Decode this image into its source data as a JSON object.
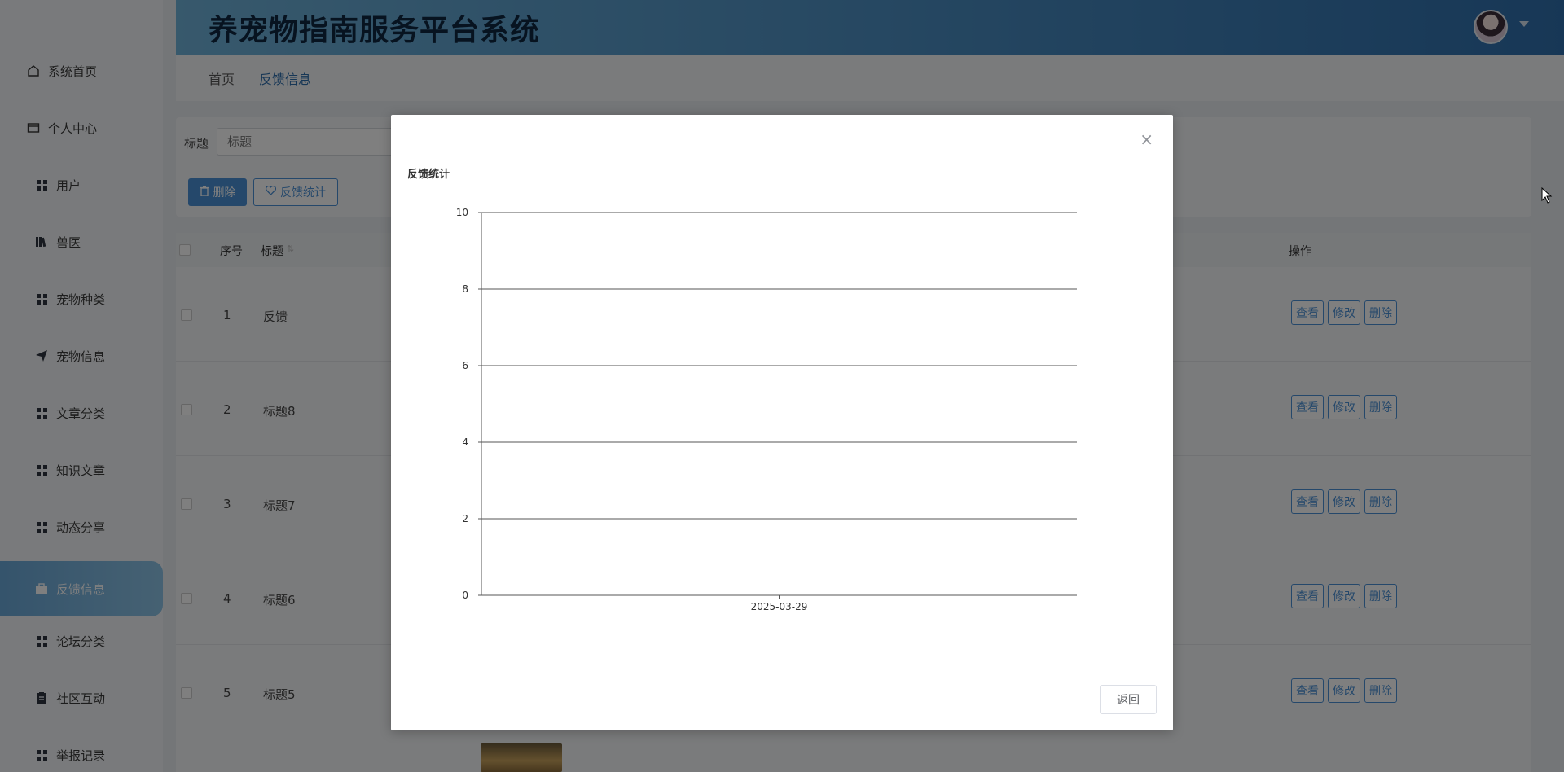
{
  "header": {
    "title": "养宠物指南服务平台系统"
  },
  "sidebar": {
    "items": [
      {
        "label": "系统首页",
        "icon": "home-icon"
      },
      {
        "label": "个人中心",
        "icon": "wallet-icon"
      },
      {
        "label": "用户",
        "icon": "grid-icon"
      },
      {
        "label": "兽医",
        "icon": "library-icon"
      },
      {
        "label": "宠物种类",
        "icon": "grid-icon"
      },
      {
        "label": "宠物信息",
        "icon": "paper-plane-icon"
      },
      {
        "label": "文章分类",
        "icon": "grid-icon"
      },
      {
        "label": "知识文章",
        "icon": "grid-icon"
      },
      {
        "label": "动态分享",
        "icon": "grid-icon"
      },
      {
        "label": "反馈信息",
        "icon": "briefcase-icon",
        "active": true
      },
      {
        "label": "论坛分类",
        "icon": "grid-icon"
      },
      {
        "label": "社区互动",
        "icon": "clipboard-icon"
      },
      {
        "label": "举报记录",
        "icon": "grid-icon"
      }
    ]
  },
  "breadcrumb": {
    "home": "首页",
    "current": "反馈信息"
  },
  "search": {
    "label": "标题",
    "placeholder": "标题",
    "delete_label": "删除",
    "stats_label": "反馈统计"
  },
  "table": {
    "headers": {
      "index": "序号",
      "title": "标题",
      "actions": "操作"
    },
    "rows": [
      {
        "index": "1",
        "title": "反馈"
      },
      {
        "index": "2",
        "title": "标题8"
      },
      {
        "index": "3",
        "title": "标题7"
      },
      {
        "index": "4",
        "title": "标题6"
      },
      {
        "index": "5",
        "title": "标题5"
      }
    ],
    "row_actions": {
      "view": "查看",
      "edit": "修改",
      "delete": "删除"
    }
  },
  "modal": {
    "back_label": "返回"
  },
  "chart_data": {
    "type": "bar",
    "title": "反馈统计",
    "categories": [
      "2025-03-29"
    ],
    "values": [
      0
    ],
    "ylim": [
      0,
      10
    ],
    "yticks": [
      0,
      2,
      4,
      6,
      8,
      10
    ],
    "grid": true
  }
}
